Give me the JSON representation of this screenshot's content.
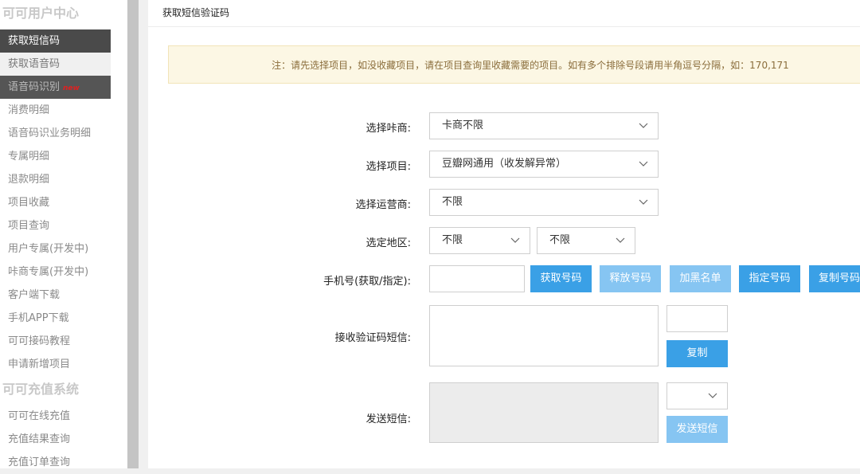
{
  "sidebar": {
    "section1": "可可用户中心",
    "items1": [
      {
        "label": "获取短信码"
      },
      {
        "label": "获取语音码"
      },
      {
        "label": "语音码识别",
        "badge": "new"
      },
      {
        "label": "消费明细"
      },
      {
        "label": "语音码识业务明细"
      },
      {
        "label": "专属明细"
      },
      {
        "label": "退款明细"
      },
      {
        "label": "项目收藏"
      },
      {
        "label": "项目查询"
      },
      {
        "label": "用户专属(开发中)"
      },
      {
        "label": "咔商专属(开发中)"
      },
      {
        "label": "客户端下载"
      },
      {
        "label": "手机APP下载"
      },
      {
        "label": "可可接码教程"
      },
      {
        "label": "申请新增项目"
      }
    ],
    "section2": "可可充值系统",
    "items2": [
      {
        "label": "可可在线充值"
      },
      {
        "label": "充值结果查询"
      },
      {
        "label": "充值订单查询"
      }
    ]
  },
  "main": {
    "title": "获取短信验证码",
    "notice": "注：请先选择项目，如没收藏项目，请在项目查询里收藏需要的项目。如有多个排除号段请用半角逗号分隔，如：170,171",
    "form": {
      "merchant_label": "选择咔商:",
      "merchant_value": "卡商不限",
      "project_label": "选择项目:",
      "project_value": "豆瓣网通用（收发解异常）",
      "carrier_label": "选择运营商:",
      "carrier_value": "不限",
      "region_label": "选定地区:",
      "region_province": "不限",
      "region_city": "不限",
      "phone_label": "手机号(获取/指定):",
      "phone_value": "",
      "btn_get": "获取号码",
      "btn_release": "释放号码",
      "btn_blacklist": "加黑名单",
      "btn_assign": "指定号码",
      "btn_copy_number": "复制号码",
      "sms_label": "接收验证码短信:",
      "sms_code_value": "",
      "btn_copy": "复制",
      "send_label": "发送短信:",
      "send_select_value": "",
      "btn_send": "发送短信"
    }
  }
}
